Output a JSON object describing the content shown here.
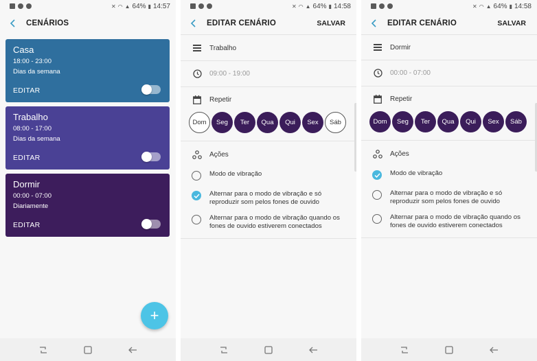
{
  "colors": {
    "card_casa": "#2f6f9e",
    "card_trabalho": "#4a4195",
    "card_dormir": "#3d1d5c",
    "day_active": "#3b1d5a",
    "accent": "#4dc4e6",
    "radio_selected": "#4ab8de"
  },
  "screens": [
    {
      "status": {
        "battery": "64%",
        "time": "14:57"
      },
      "title": "CENÁRIOS",
      "cards": [
        {
          "name": "Casa",
          "time": "18:00 - 23:00",
          "repeat": "Dias da semana",
          "edit": "EDITAR",
          "enabled": false
        },
        {
          "name": "Trabalho",
          "time": "08:00 - 17:00",
          "repeat": "Dias da semana",
          "edit": "EDITAR",
          "enabled": false
        },
        {
          "name": "Dormir",
          "time": "00:00 - 07:00",
          "repeat": "Diariamente",
          "edit": "EDITAR",
          "enabled": false
        }
      ],
      "fab_label": "+"
    },
    {
      "status": {
        "battery": "64%",
        "time": "14:58"
      },
      "title": "EDITAR CENÁRIO",
      "save": "SALVAR",
      "name": "Trabalho",
      "time": "09:00 - 19:00",
      "repeat_label": "Repetir",
      "days": [
        {
          "label": "Dom",
          "active": false
        },
        {
          "label": "Seg",
          "active": true
        },
        {
          "label": "Ter",
          "active": true
        },
        {
          "label": "Qua",
          "active": true
        },
        {
          "label": "Qui",
          "active": true
        },
        {
          "label": "Sex",
          "active": true
        },
        {
          "label": "Sáb",
          "active": false
        }
      ],
      "actions_label": "Ações",
      "options": [
        {
          "text": "Modo de vibração",
          "selected": false
        },
        {
          "text": "Alternar para o modo de vibração e só reproduzir som pelos fones de ouvido",
          "selected": true
        },
        {
          "text": "Alternar para o modo de vibração quando os fones de ouvido estiverem conectados",
          "selected": false
        }
      ]
    },
    {
      "status": {
        "battery": "64%",
        "time": "14:58"
      },
      "title": "EDITAR CENÁRIO",
      "save": "SALVAR",
      "name": "Dormir",
      "time": "00:00 - 07:00",
      "repeat_label": "Repetir",
      "days": [
        {
          "label": "Dom",
          "active": true
        },
        {
          "label": "Seg",
          "active": true
        },
        {
          "label": "Ter",
          "active": true
        },
        {
          "label": "Qua",
          "active": true
        },
        {
          "label": "Qui",
          "active": true
        },
        {
          "label": "Sex",
          "active": true
        },
        {
          "label": "Sáb",
          "active": true
        }
      ],
      "actions_label": "Ações",
      "options": [
        {
          "text": "Modo de vibração",
          "selected": true
        },
        {
          "text": "Alternar para o modo de vibração e só reproduzir som pelos fones de ouvido",
          "selected": false
        },
        {
          "text": "Alternar para o modo de vibração quando os fones de ouvido estiverem conectados",
          "selected": false
        }
      ]
    }
  ],
  "icons": {
    "back": "arrow-left-icon",
    "name_field": "menu-lines-icon",
    "time_field": "clock-icon",
    "repeat": "calendar-icon",
    "actions": "nodes-icon",
    "nav_recent": "recent-apps-icon",
    "nav_home": "home-icon",
    "nav_back": "nav-back-icon"
  }
}
